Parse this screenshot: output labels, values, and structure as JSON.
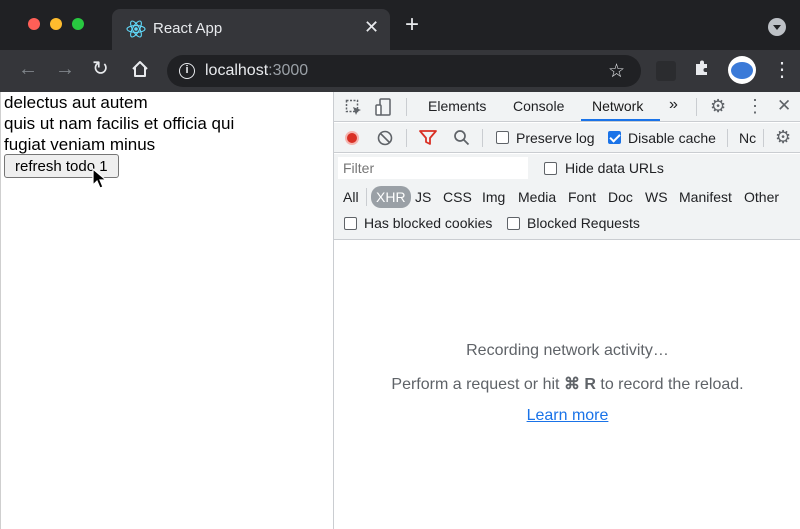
{
  "browser": {
    "tab_title": "React App",
    "tab_close": "✕",
    "new_tab": "+",
    "url_host": "localhost",
    "url_port": ":3000"
  },
  "page": {
    "todo_lines": [
      "delectus aut autem",
      "quis ut nam facilis et officia qui",
      "fugiat veniam minus"
    ],
    "refresh_button": "refresh todo 1"
  },
  "devtools": {
    "tabs": [
      "Elements",
      "Console",
      "Network"
    ],
    "active_tab": "Network",
    "more_tabs": "»",
    "preserve_log": {
      "label": "Preserve log",
      "checked": false
    },
    "disable_cache": {
      "label": "Disable cache",
      "checked": true
    },
    "throttle_truncated": "Nc",
    "filter_placeholder": "Filter",
    "hide_data_urls": {
      "label": "Hide data URLs",
      "checked": false
    },
    "type_filters": [
      "All",
      "XHR",
      "JS",
      "CSS",
      "Img",
      "Media",
      "Font",
      "Doc",
      "WS",
      "Manifest",
      "Other"
    ],
    "active_type": "XHR",
    "has_blocked_cookies": {
      "label": "Has blocked cookies",
      "checked": false
    },
    "blocked_requests": {
      "label": "Blocked Requests",
      "checked": false
    },
    "empty_title": "Recording network activity…",
    "empty_hint_prefix": "Perform a request or hit",
    "empty_hint_keys": "⌘ R",
    "empty_hint_suffix": "to record the reload.",
    "learn_more": "Learn more"
  },
  "colors": {
    "accent": "#1a73e8",
    "record": "#d93025",
    "chrome_dark": "#202124"
  }
}
